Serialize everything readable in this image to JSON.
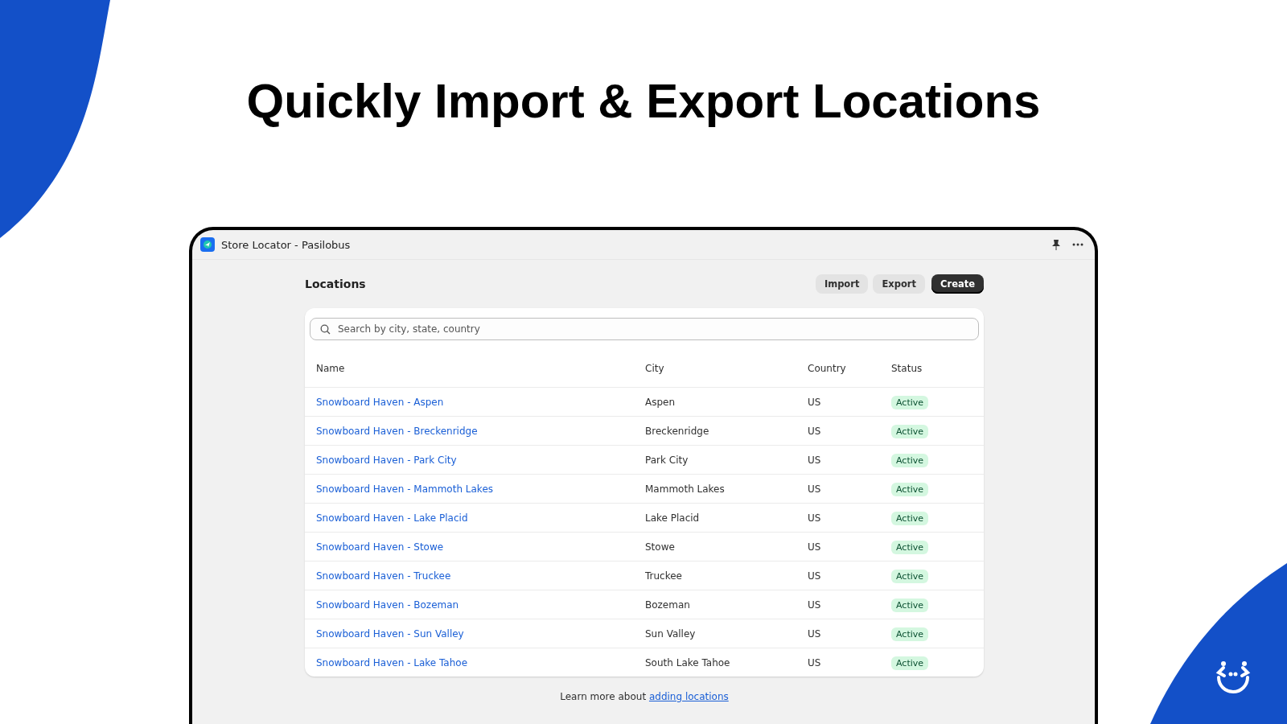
{
  "headline": "Quickly Import & Export Locations",
  "window": {
    "title": "Store Locator - Pasilobus"
  },
  "page": {
    "title": "Locations",
    "buttons": [
      {
        "label": "Import",
        "kind": "secondary"
      },
      {
        "label": "Export",
        "kind": "secondary"
      },
      {
        "label": "Create",
        "kind": "primary"
      }
    ]
  },
  "search": {
    "placeholder": "Search by city, state, country"
  },
  "table": {
    "columns": [
      "Name",
      "City",
      "Country",
      "Status"
    ],
    "rows": [
      {
        "name": "Snowboard Haven - Aspen",
        "city": "Aspen",
        "country": "US",
        "status": "Active"
      },
      {
        "name": "Snowboard Haven - Breckenridge",
        "city": "Breckenridge",
        "country": "US",
        "status": "Active"
      },
      {
        "name": "Snowboard Haven - Park City",
        "city": "Park City",
        "country": "US",
        "status": "Active"
      },
      {
        "name": "Snowboard Haven - Mammoth Lakes",
        "city": "Mammoth Lakes",
        "country": "US",
        "status": "Active"
      },
      {
        "name": "Snowboard Haven - Lake Placid",
        "city": "Lake Placid",
        "country": "US",
        "status": "Active"
      },
      {
        "name": "Snowboard Haven - Stowe",
        "city": "Stowe",
        "country": "US",
        "status": "Active"
      },
      {
        "name": "Snowboard Haven - Truckee",
        "city": "Truckee",
        "country": "US",
        "status": "Active"
      },
      {
        "name": "Snowboard Haven - Bozeman",
        "city": "Bozeman",
        "country": "US",
        "status": "Active"
      },
      {
        "name": "Snowboard Haven - Sun Valley",
        "city": "Sun Valley",
        "country": "US",
        "status": "Active"
      },
      {
        "name": "Snowboard Haven - Lake Tahoe",
        "city": "South Lake Tahoe",
        "country": "US",
        "status": "Active"
      }
    ]
  },
  "footer": {
    "text": "Learn more about",
    "link": "adding locations"
  }
}
